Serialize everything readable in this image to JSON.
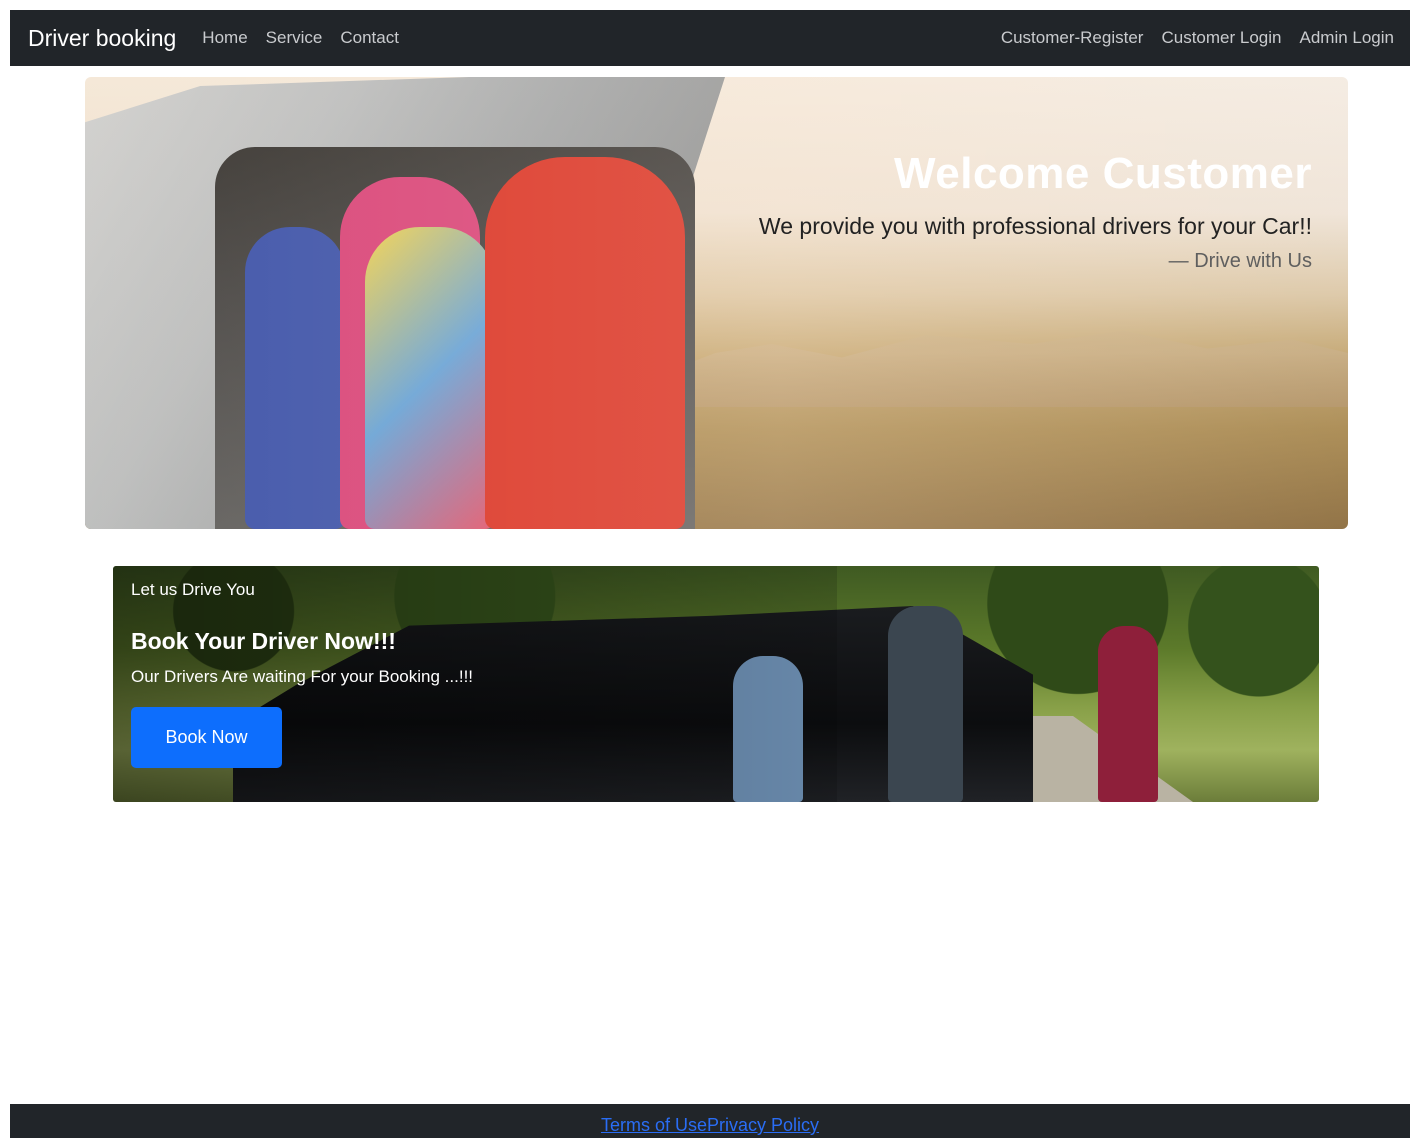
{
  "navbar": {
    "brand": "Driver booking",
    "left_links": [
      "Home",
      "Service",
      "Contact"
    ],
    "right_links": [
      "Customer-Register",
      "Customer Login",
      "Admin Login"
    ]
  },
  "hero": {
    "title": "Welcome Customer",
    "subtitle": "We provide you with professional drivers for your Car!!",
    "signature": "— Drive with Us"
  },
  "booking": {
    "kicker": "Let us Drive You",
    "title": "Book Your Driver Now!!!",
    "text": "Our Drivers Are waiting For your Booking ...!!!",
    "button_label": "Book Now"
  },
  "footer": {
    "terms_label": "Terms of Use",
    "privacy_label": "Privacy Policy"
  },
  "colors": {
    "navbar_bg": "#212529",
    "primary_button": "#0d6efd",
    "footer_link": "#2a6df4"
  }
}
